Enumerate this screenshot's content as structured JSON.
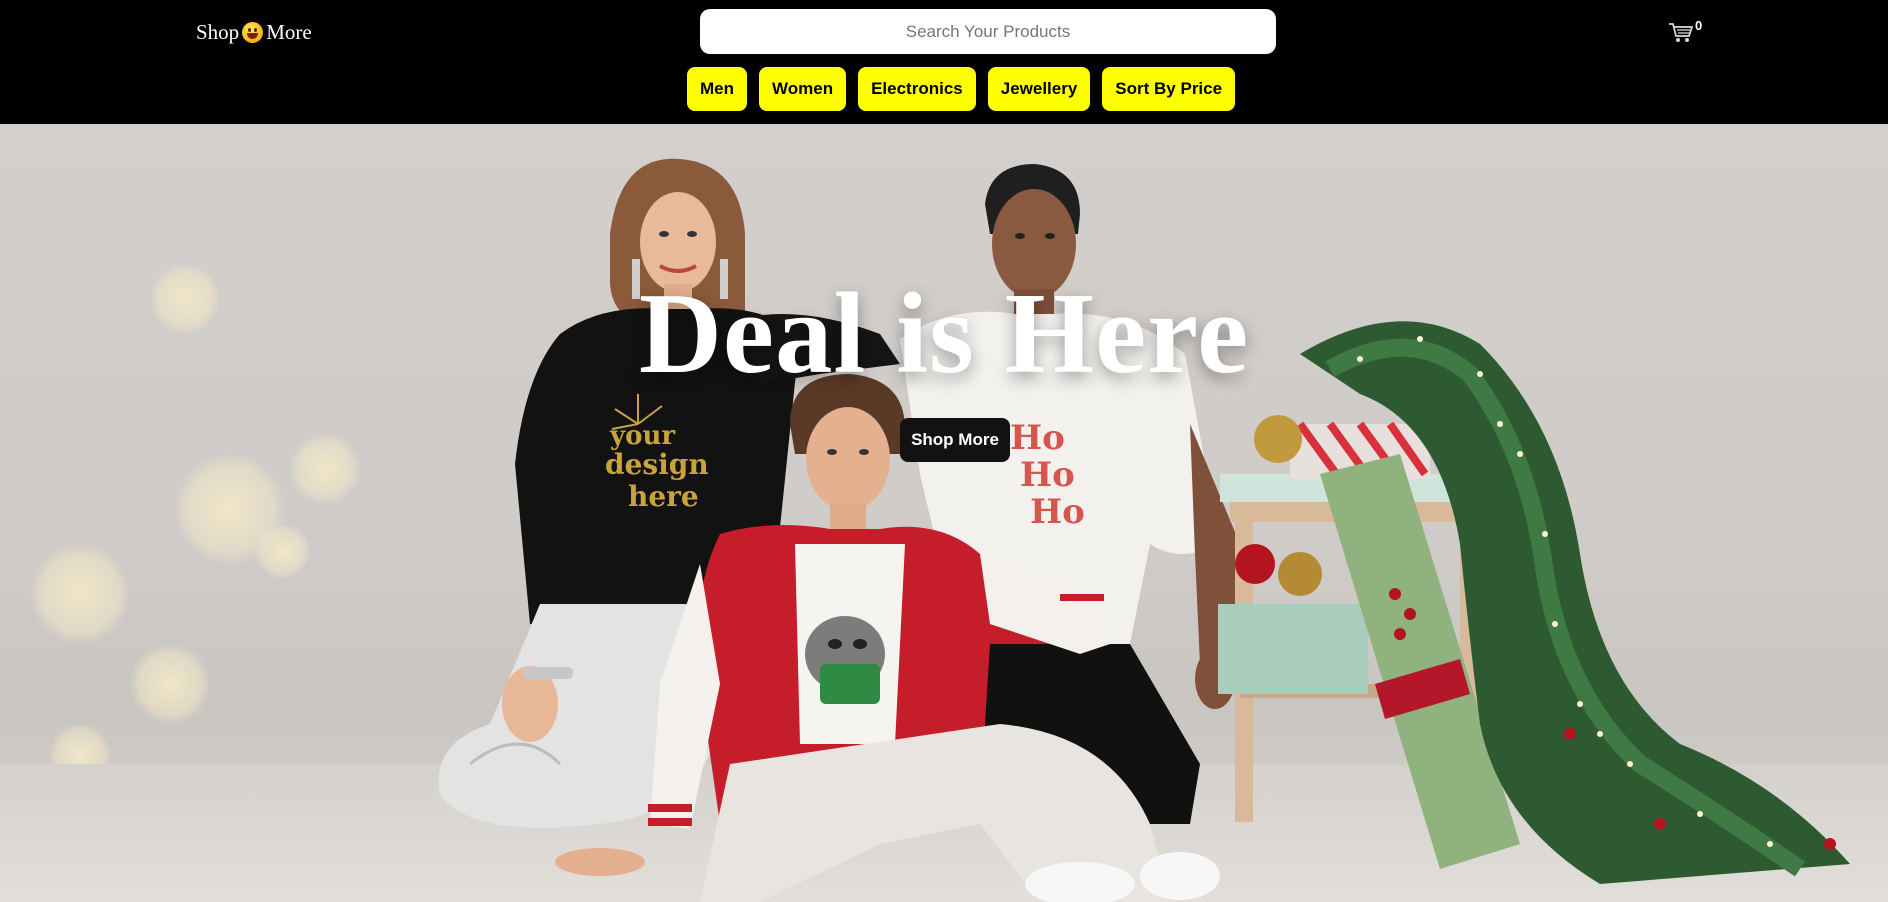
{
  "brand": {
    "left": "Shop",
    "right": "More",
    "icon": "grinning-face-emoji-icon"
  },
  "search": {
    "placeholder": "Search Your Products",
    "value": ""
  },
  "cart": {
    "icon": "cart-icon",
    "count": "0"
  },
  "categories": [
    {
      "label": "Men"
    },
    {
      "label": "Women"
    },
    {
      "label": "Electronics"
    },
    {
      "label": "Jewellery"
    },
    {
      "label": "Sort By Price"
    }
  ],
  "hero": {
    "title": "Deal is Here",
    "cta": "Shop More",
    "sweater_print": "your design here",
    "shirt_print": "Ho Ho Ho"
  },
  "colors": {
    "header_bg": "#000000",
    "category_bg": "#ffff00",
    "cta_bg": "#121212",
    "hero_text": "#ffffff"
  }
}
